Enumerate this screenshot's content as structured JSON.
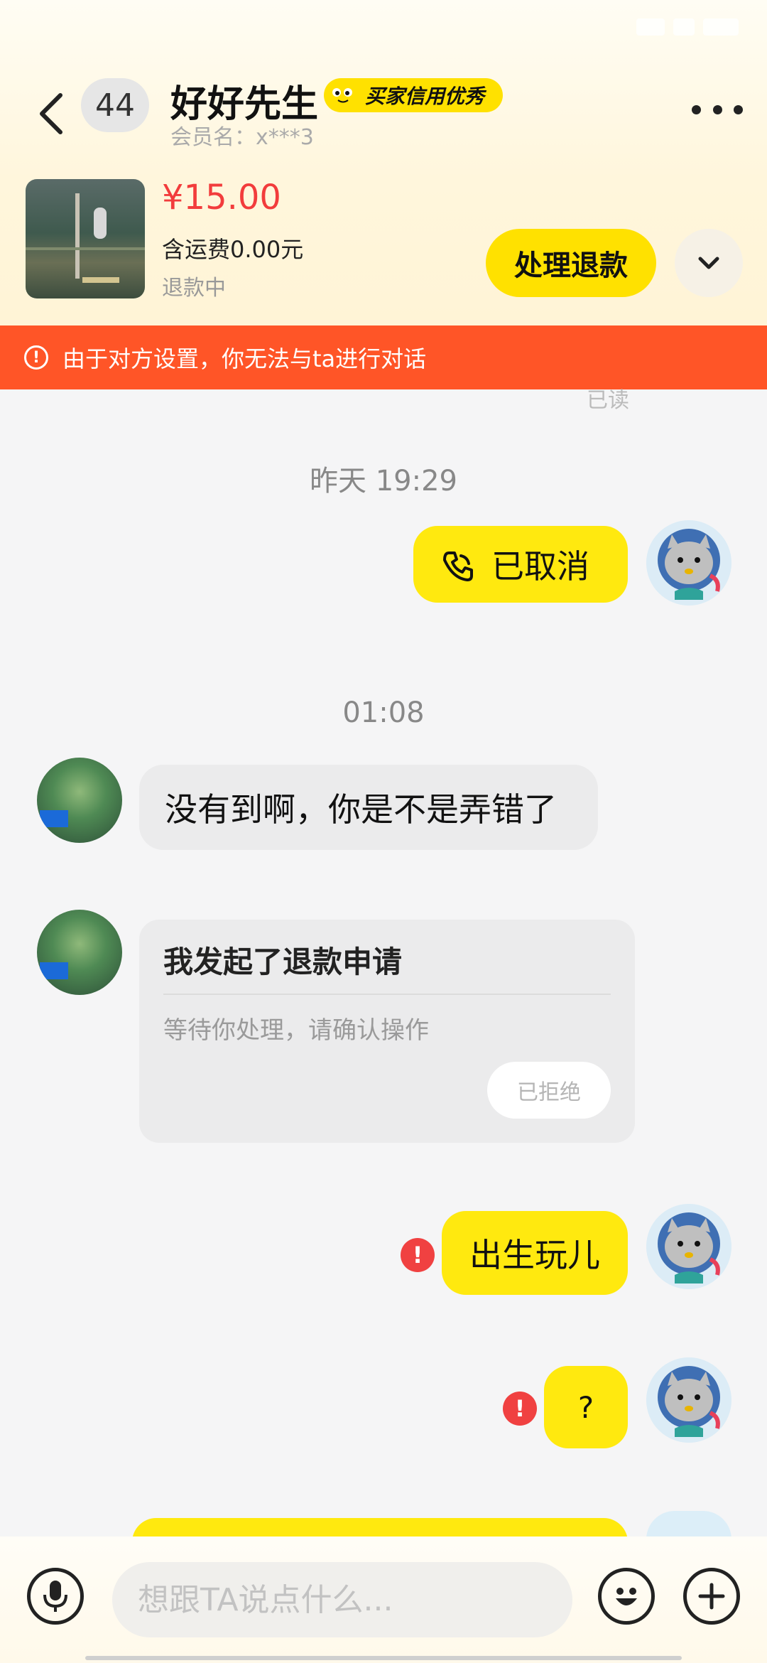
{
  "header": {
    "unread_count": "44",
    "contact_name": "好好先生",
    "credit_badge": "买家信用优秀",
    "member_id": "会员名：x***3"
  },
  "product": {
    "price": "¥15.00",
    "shipping": "含运费0.00元",
    "status": "退款中",
    "action_label": "处理退款"
  },
  "banner": {
    "text": "由于对方设置，你无法与ta进行对话"
  },
  "chat": {
    "read_label": "已读",
    "messages": [
      {
        "time": "昨天 19:29"
      },
      {
        "from": "me",
        "type": "call",
        "text": "已取消"
      },
      {
        "time": "01:08"
      },
      {
        "from": "them",
        "text": "没有到啊，你是不是弄错了"
      },
      {
        "from": "them",
        "type": "refund_card",
        "title": "我发起了退款申请",
        "subtitle": "等待你处理，请确认操作",
        "status": "已拒绝"
      },
      {
        "from": "me",
        "text": "出生玩儿",
        "failed": true
      },
      {
        "from": "me",
        "text": "?",
        "failed": true
      }
    ]
  },
  "input": {
    "placeholder": "想跟TA说点什么..."
  },
  "colors": {
    "accent": "#ffe100",
    "banner": "#ff5527",
    "price": "#f23c3c",
    "error": "#f04141"
  }
}
